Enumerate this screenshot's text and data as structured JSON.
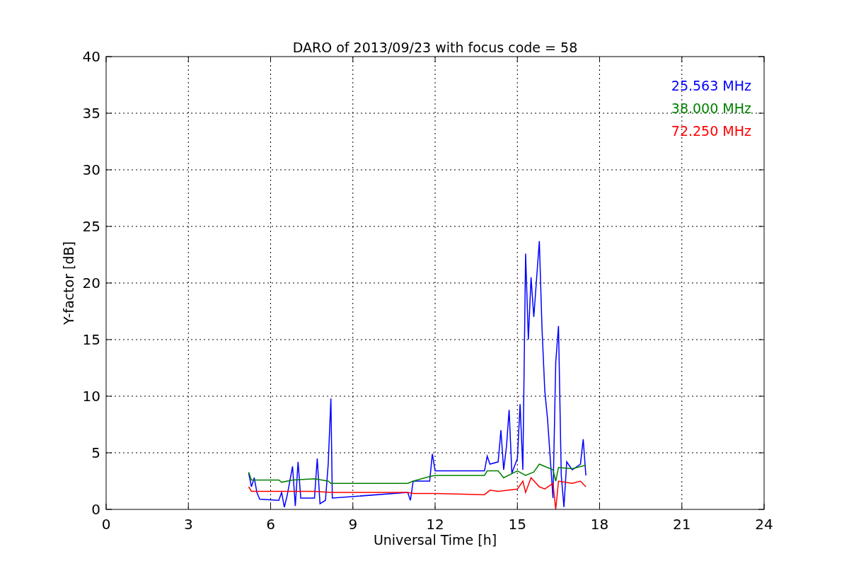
{
  "chart_data": {
    "type": "line",
    "title": "DARO of 2013/09/23 with focus code = 58",
    "xlabel": "Universal Time [h]",
    "ylabel": "Y-factor [dB]",
    "xlim": [
      0,
      24
    ],
    "ylim": [
      0,
      40
    ],
    "xticks": [
      0,
      3,
      6,
      9,
      12,
      15,
      18,
      21,
      24
    ],
    "yticks": [
      0,
      5,
      10,
      15,
      20,
      25,
      30,
      35,
      40
    ],
    "grid": true,
    "series": [
      {
        "name": "25.563 MHz",
        "color": "#0000ff",
        "x": [
          5.2,
          5.3,
          5.4,
          5.5,
          5.6,
          6.3,
          6.4,
          6.5,
          6.6,
          6.8,
          6.9,
          7.0,
          7.1,
          7.6,
          7.7,
          7.8,
          8.0,
          8.1,
          8.2,
          8.25,
          11.0,
          11.1,
          11.2,
          11.8,
          11.9,
          12.0,
          13.8,
          13.9,
          14.0,
          14.3,
          14.4,
          14.5,
          14.6,
          14.7,
          14.8,
          15.0,
          15.1,
          15.2,
          15.3,
          15.4,
          15.5,
          15.6,
          15.8,
          15.9,
          16.0,
          16.1,
          16.3,
          16.4,
          16.5,
          16.6,
          16.7,
          16.8,
          17.0,
          17.3,
          17.4,
          17.5
        ],
        "values": [
          3.2,
          2.0,
          2.8,
          1.5,
          0.9,
          0.8,
          1.5,
          0.2,
          1.2,
          3.8,
          0.3,
          4.2,
          1.0,
          1.0,
          4.5,
          0.5,
          0.8,
          4.0,
          9.8,
          1.0,
          1.5,
          0.8,
          2.5,
          2.5,
          4.9,
          3.4,
          3.4,
          4.7,
          4.0,
          4.2,
          7.0,
          3.5,
          5.5,
          8.8,
          3.2,
          4.5,
          9.3,
          3.5,
          22.6,
          15.0,
          20.5,
          17.0,
          23.7,
          16.0,
          10.5,
          8.0,
          1.0,
          13.0,
          16.2,
          3.0,
          0.2,
          4.2,
          3.5,
          4.0,
          6.2,
          3.0
        ]
      },
      {
        "name": "38.000 MHz",
        "color": "#008000",
        "x": [
          5.2,
          5.3,
          6.3,
          6.4,
          6.8,
          7.6,
          8.1,
          8.2,
          11.0,
          11.2,
          11.8,
          12.0,
          13.8,
          13.9,
          14.3,
          14.5,
          15.0,
          15.3,
          15.6,
          15.8,
          16.0,
          16.3,
          16.4,
          16.5,
          17.0,
          17.5
        ],
        "values": [
          3.3,
          2.6,
          2.6,
          2.4,
          2.6,
          2.7,
          2.5,
          2.3,
          2.3,
          2.5,
          2.9,
          3.0,
          3.0,
          3.4,
          3.4,
          2.8,
          3.4,
          3.0,
          3.3,
          4.0,
          3.8,
          3.5,
          2.5,
          3.7,
          3.6,
          3.9
        ]
      },
      {
        "name": "72.250 MHz",
        "color": "#ff0000",
        "x": [
          5.2,
          5.3,
          6.3,
          6.8,
          7.6,
          8.2,
          11.0,
          11.2,
          11.8,
          12.0,
          13.8,
          14.0,
          14.3,
          15.0,
          15.2,
          15.3,
          15.5,
          15.8,
          16.0,
          16.3,
          16.4,
          16.5,
          17.0,
          17.3,
          17.5
        ],
        "values": [
          2.0,
          1.6,
          1.6,
          1.6,
          1.6,
          1.5,
          1.5,
          1.4,
          1.4,
          1.4,
          1.3,
          1.7,
          1.6,
          1.8,
          2.5,
          1.5,
          2.8,
          2.0,
          1.8,
          2.3,
          0.0,
          2.5,
          2.3,
          2.5,
          2.0
        ]
      }
    ]
  }
}
